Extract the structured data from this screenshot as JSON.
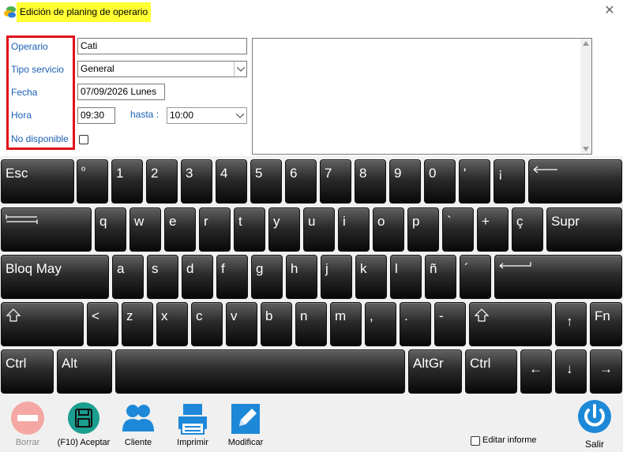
{
  "window": {
    "title": "Edición de planing de operario",
    "close_glyph": "✕",
    "highlight_color": "#ffff33"
  },
  "form": {
    "labels": {
      "operario": "Operario",
      "tipo_servicio": "Tipo servicio",
      "fecha": "Fecha",
      "hora": "Hora",
      "no_disponible": "No disponible",
      "hasta": "hasta :"
    },
    "values": {
      "operario": "Cati",
      "tipo_servicio": "General",
      "fecha": "07/09/2026 Lunes",
      "hora": "09:30",
      "hasta": "10:00"
    },
    "no_disponible_checked": false,
    "label_color": "#1a5fb4",
    "annotation_color": "#e0101a"
  },
  "keyboard": {
    "rows": [
      [
        "Esc",
        "º",
        "1",
        "2",
        "3",
        "4",
        "5",
        "6",
        "7",
        "8",
        "9",
        "0",
        "'",
        "¡",
        "backspace"
      ],
      [
        "tab",
        "q",
        "w",
        "e",
        "r",
        "t",
        "y",
        "u",
        "i",
        "o",
        "p",
        "`",
        "+",
        "ç",
        "Supr"
      ],
      [
        "Bloq May",
        "a",
        "s",
        "d",
        "f",
        "g",
        "h",
        "j",
        "k",
        "l",
        "ñ",
        "´",
        "enter"
      ],
      [
        "shift",
        "<",
        "z",
        "x",
        "c",
        "v",
        "b",
        "n",
        "m",
        ",",
        ".",
        "-",
        "shift",
        "↑",
        "Fn"
      ],
      [
        "Ctrl",
        "Alt",
        "",
        "AltGr",
        "Ctrl",
        "←",
        "↓",
        "→"
      ]
    ]
  },
  "toolbar": {
    "borrar": "Borrar",
    "aceptar": "(F10) Aceptar",
    "cliente": "Cliente",
    "imprimir": "Imprimir",
    "modificar": "Modificar",
    "editar_informe": "Editar informe",
    "salir": "Salir",
    "colors": {
      "borrar": "#f4a7a3",
      "aceptar": "#1a9e8f",
      "blue": "#1e88d8"
    }
  }
}
